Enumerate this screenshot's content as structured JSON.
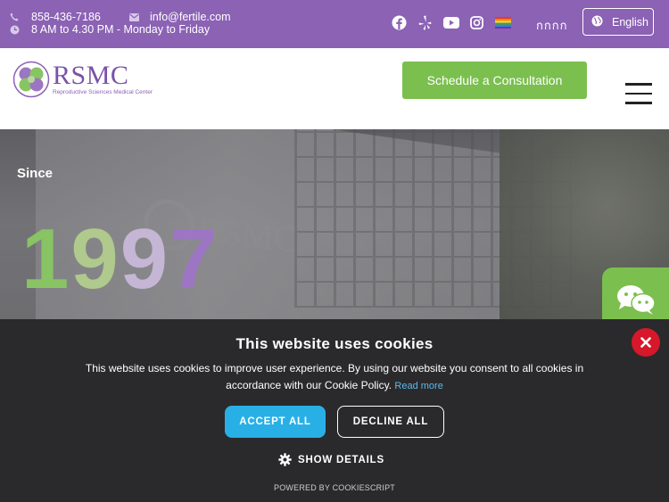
{
  "topbar": {
    "phone": "858-436-7186",
    "email": "info@fertile.com",
    "hours": "8 AM to 4.30 PM - Monday to Friday",
    "lang_glyphs": "กกกก",
    "language": "English",
    "bg_color": "#8b62b4"
  },
  "header": {
    "logo_text": "RSMC",
    "logo_subtext": "Reproductive Sciences Medical Center",
    "cta_label": "Schedule a Consultation",
    "cta_color": "#7bbf4e"
  },
  "hero": {
    "since": "Since",
    "year_digits": [
      "1",
      "9",
      "9",
      "7"
    ]
  },
  "cookie": {
    "title": "This website uses cookies",
    "text": "This website uses cookies to improve user experience. By using our website you consent to all cookies in accordance with our Cookie Policy.",
    "read_more": "Read more",
    "accept": "ACCEPT ALL",
    "decline": "DECLINE ALL",
    "show_details": "SHOW DETAILS",
    "powered": "POWERED BY COOKIESCRIPT",
    "accent_color": "#28b0e6"
  }
}
